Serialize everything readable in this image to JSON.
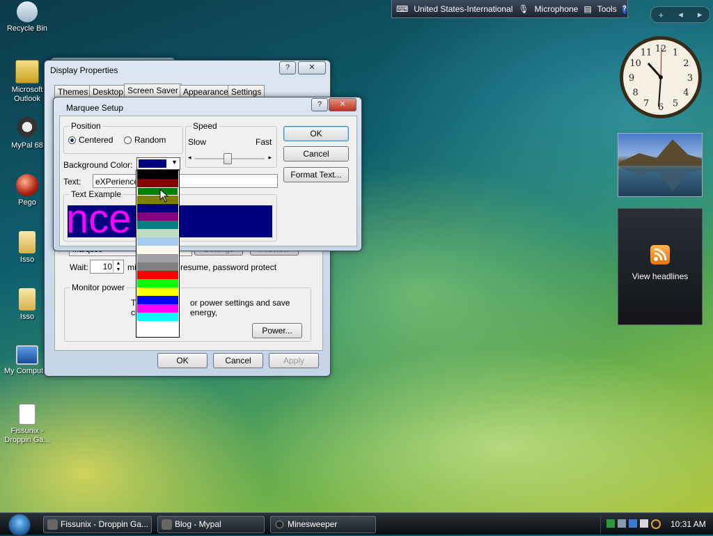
{
  "desktop": {
    "icons": [
      {
        "label": "Recycle Bin"
      },
      {
        "label": "Microsoft Outlook"
      },
      {
        "label": "MyPal 68"
      },
      {
        "label": "Pego"
      },
      {
        "label": "Isso"
      },
      {
        "label": "Isso"
      },
      {
        "label": "My Computer"
      },
      {
        "label": "Fissunix - Droppin Ga..."
      }
    ]
  },
  "language_bar": {
    "language": "United States-International",
    "microphone": "Microphone",
    "tools": "Tools",
    "help": "?"
  },
  "sidebar": {
    "controls": {
      "add": "+",
      "prev": "◂",
      "next": "▸"
    },
    "clock": {
      "numbers": [
        "12",
        "1",
        "2",
        "3",
        "4",
        "5",
        "6",
        "7",
        "8",
        "9",
        "10",
        "11"
      ]
    },
    "feed": {
      "label": "View headlines"
    }
  },
  "display_properties": {
    "title": "Display Properties",
    "help": "?",
    "close": "✕",
    "tabs": [
      {
        "label": "Themes"
      },
      {
        "label": "Desktop"
      },
      {
        "label": "Screen Saver"
      },
      {
        "label": "Appearance"
      },
      {
        "label": "Settings"
      }
    ],
    "screen_saver_value": "Marquee",
    "settings_button": "Settings",
    "preview_button": "Preview",
    "wait_label": "Wait:",
    "wait_value": "10",
    "wait_suffix": "min",
    "resume_text": "resume, password protect",
    "monitor_power": {
      "group": "Monitor power",
      "text_start": "T",
      "text_start2": "cl",
      "text": "or power settings and save energy,",
      "power_button": "Power..."
    },
    "ok": "OK",
    "cancel": "Cancel",
    "apply": "Apply"
  },
  "marquee_setup": {
    "title": "Marquee Setup",
    "help": "?",
    "close": "✕",
    "position": {
      "group": "Position",
      "centered": "Centered",
      "random": "Random",
      "selected": "Centered"
    },
    "speed": {
      "group": "Speed",
      "slow": "Slow",
      "fast": "Fast",
      "level": 0.6
    },
    "background_color_label": "Background Color:",
    "background_color_value": "#000080",
    "text_label": "Text:",
    "text_value": "eXPerience",
    "text_example": {
      "group": "Text Example",
      "preview_text": "nce"
    },
    "ok": "OK",
    "cancel": "Cancel",
    "format_text": "Format Text..."
  },
  "color_dropdown": {
    "options": [
      "#000000",
      "#800000",
      "#008000",
      "#808000",
      "#000080",
      "#800080",
      "#008080",
      "#c0dcc0",
      "#a6caf0",
      "#fffbf0",
      "#a0a0a4",
      "#808080",
      "#ff0000",
      "#00ff00",
      "#ffff00",
      "#0000ff",
      "#ff00ff",
      "#00ffff",
      "#ffffff"
    ],
    "highlighted": "#008000"
  },
  "taskbar": {
    "buttons": [
      {
        "label": "Fissunix - Droppin Ga..."
      },
      {
        "label": "Blog - Mypal"
      },
      {
        "label": "Minesweeper"
      }
    ],
    "time": "10:31 AM"
  }
}
